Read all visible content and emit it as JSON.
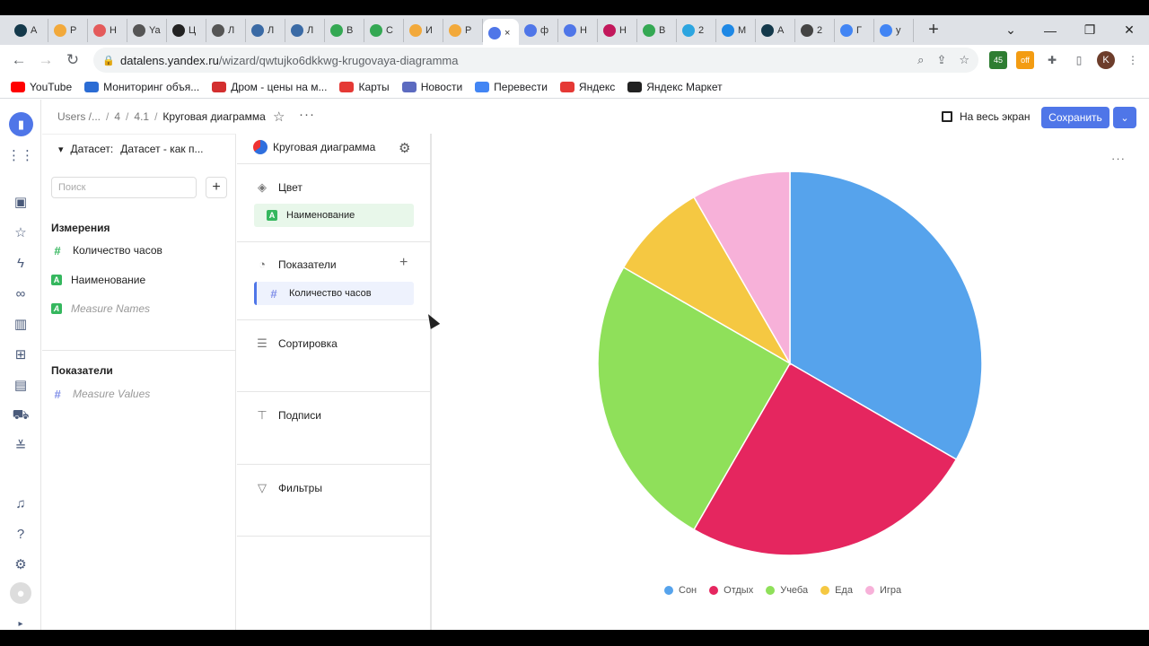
{
  "browser": {
    "tabs": [
      {
        "label": "А",
        "color": "#14394b"
      },
      {
        "label": "Р",
        "color": "#f2a93b"
      },
      {
        "label": "Н",
        "color": "#e45b5b"
      },
      {
        "label": "Ya",
        "color": "#555555"
      },
      {
        "label": "Ц",
        "color": "#222222"
      },
      {
        "label": "Л",
        "color": "#555555"
      },
      {
        "label": "Л",
        "color": "#3a6aa5"
      },
      {
        "label": "Л",
        "color": "#3a6aa5"
      },
      {
        "label": "В",
        "color": "#34a853"
      },
      {
        "label": "С",
        "color": "#34a853"
      },
      {
        "label": "И",
        "color": "#f2a93b"
      },
      {
        "label": "Р",
        "color": "#f2a93b"
      },
      {
        "label": "×",
        "color": "#4f76e8"
      },
      {
        "label": "ф",
        "color": "#4f76e8"
      },
      {
        "label": "Н",
        "color": "#4f76e8"
      },
      {
        "label": "Н",
        "color": "#c2185b"
      },
      {
        "label": "В",
        "color": "#34a853"
      },
      {
        "label": "2",
        "color": "#2ca5e0"
      },
      {
        "label": "М",
        "color": "#1e88e5"
      },
      {
        "label": "А",
        "color": "#14394b"
      },
      {
        "label": "2",
        "color": "#444444"
      },
      {
        "label": "Г",
        "color": "#4285f4"
      },
      {
        "label": "у",
        "color": "#4285f4"
      }
    ],
    "new_tab": "+",
    "url_host": "datalens.yandex.ru",
    "url_path": "/wizard/qwtujko6dkkwg-krugovaya-diagramma",
    "profile_initial": "K",
    "ext_badge": "45",
    "ext_off": "off",
    "bookmarks": [
      {
        "label": "YouTube",
        "color": "#ff0000"
      },
      {
        "label": "Мониторинг объя...",
        "color": "#2b6cd4"
      },
      {
        "label": "Дром - цены на м...",
        "color": "#d32f2f"
      },
      {
        "label": "Карты",
        "color": "#e53935"
      },
      {
        "label": "Новости",
        "color": "#5c6bc0"
      },
      {
        "label": "Перевести",
        "color": "#4285f4"
      },
      {
        "label": "Яндекс",
        "color": "#e53935"
      },
      {
        "label": "Яндекс Маркет",
        "color": "#222222"
      }
    ]
  },
  "header": {
    "crumbs": [
      "Users /...",
      "4",
      "4.1"
    ],
    "title": "Круговая диаграмма",
    "fullscreen_label": "На весь экран",
    "save_label": "Сохранить"
  },
  "dataset": {
    "label": "Датасет:",
    "name": "Датасет - как п...",
    "search_placeholder": "Поиск",
    "dimensions_title": "Измерения",
    "dimensions": [
      {
        "label": "Количество часов",
        "kind": "number"
      },
      {
        "label": "Наименование",
        "kind": "string"
      },
      {
        "label": "Measure Names",
        "kind": "string-italic"
      }
    ],
    "measures_title": "Показатели",
    "measures": [
      {
        "label": "Measure Values",
        "kind": "number-italic"
      }
    ]
  },
  "visualization": {
    "type_label": "Круговая диаграмма",
    "color_section": "Цвет",
    "color_field": "Наименование",
    "measures_section": "Показатели",
    "measures_field": "Количество часов",
    "sort_section": "Сортировка",
    "labels_section": "Подписи",
    "filters_section": "Фильтры"
  },
  "chart_data": {
    "type": "pie",
    "categories": [
      "Сон",
      "Отдых",
      "Учеба",
      "Еда",
      "Игра"
    ],
    "values": [
      8,
      6,
      6,
      2,
      2
    ],
    "colors": [
      "#56a3ec",
      "#e5265f",
      "#8fe05a",
      "#f5c842",
      "#f7b1d9"
    ],
    "title": "",
    "legend": "bottom"
  }
}
